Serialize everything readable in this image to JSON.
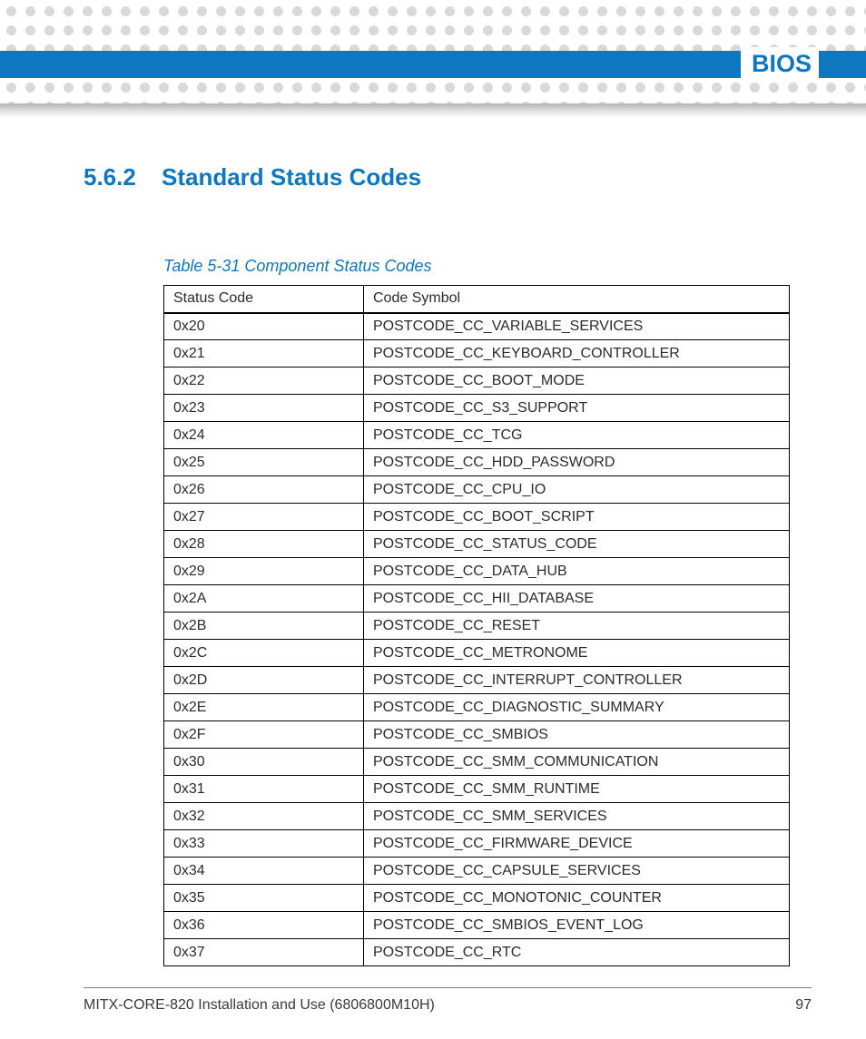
{
  "header": {
    "title": "BIOS"
  },
  "section": {
    "number": "5.6.2",
    "title": "Standard Status Codes"
  },
  "table": {
    "caption": "Table 5-31 Component Status Codes",
    "columns": [
      "Status Code",
      "Code Symbol"
    ],
    "rows": [
      {
        "code": "0x20",
        "symbol": "POSTCODE_CC_VARIABLE_SERVICES"
      },
      {
        "code": "0x21",
        "symbol": "POSTCODE_CC_KEYBOARD_CONTROLLER"
      },
      {
        "code": "0x22",
        "symbol": "POSTCODE_CC_BOOT_MODE"
      },
      {
        "code": "0x23",
        "symbol": "POSTCODE_CC_S3_SUPPORT"
      },
      {
        "code": "0x24",
        "symbol": "POSTCODE_CC_TCG"
      },
      {
        "code": "0x25",
        "symbol": "POSTCODE_CC_HDD_PASSWORD"
      },
      {
        "code": "0x26",
        "symbol": "POSTCODE_CC_CPU_IO"
      },
      {
        "code": "0x27",
        "symbol": "POSTCODE_CC_BOOT_SCRIPT"
      },
      {
        "code": "0x28",
        "symbol": "POSTCODE_CC_STATUS_CODE"
      },
      {
        "code": "0x29",
        "symbol": "POSTCODE_CC_DATA_HUB"
      },
      {
        "code": "0x2A",
        "symbol": "POSTCODE_CC_HII_DATABASE"
      },
      {
        "code": "0x2B",
        "symbol": "POSTCODE_CC_RESET"
      },
      {
        "code": "0x2C",
        "symbol": "POSTCODE_CC_METRONOME"
      },
      {
        "code": "0x2D",
        "symbol": "POSTCODE_CC_INTERRUPT_CONTROLLER"
      },
      {
        "code": "0x2E",
        "symbol": "POSTCODE_CC_DIAGNOSTIC_SUMMARY"
      },
      {
        "code": "0x2F",
        "symbol": "POSTCODE_CC_SMBIOS"
      },
      {
        "code": "0x30",
        "symbol": "POSTCODE_CC_SMM_COMMUNICATION"
      },
      {
        "code": "0x31",
        "symbol": "POSTCODE_CC_SMM_RUNTIME"
      },
      {
        "code": "0x32",
        "symbol": "POSTCODE_CC_SMM_SERVICES"
      },
      {
        "code": "0x33",
        "symbol": "POSTCODE_CC_FIRMWARE_DEVICE"
      },
      {
        "code": "0x34",
        "symbol": "POSTCODE_CC_CAPSULE_SERVICES"
      },
      {
        "code": "0x35",
        "symbol": "POSTCODE_CC_MONOTONIC_COUNTER"
      },
      {
        "code": "0x36",
        "symbol": "POSTCODE_CC_SMBIOS_EVENT_LOG"
      },
      {
        "code": "0x37",
        "symbol": "POSTCODE_CC_RTC"
      }
    ]
  },
  "footer": {
    "doc_title": "MITX-CORE-820 Installation and Use (6806800M10H)",
    "page_number": "97"
  }
}
